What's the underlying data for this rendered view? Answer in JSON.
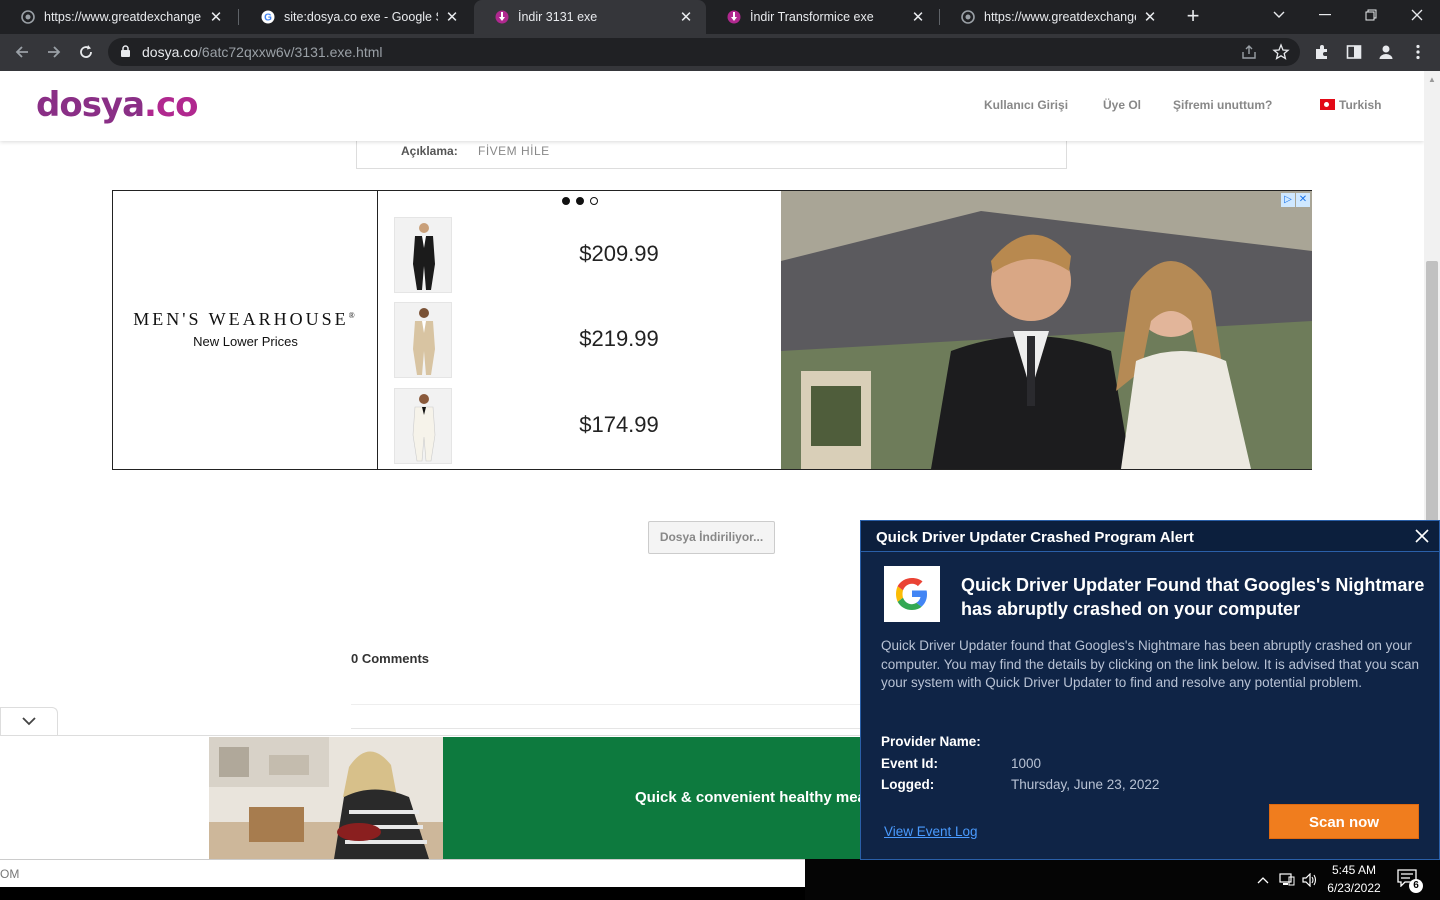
{
  "browser": {
    "tabs": [
      {
        "title": "https://www.greatdexchange.co",
        "icon": "globe-icon",
        "active": false
      },
      {
        "title": "site:dosya.co exe - Google Sear",
        "icon": "google-icon",
        "active": false
      },
      {
        "title": "İndir 3131 exe",
        "icon": "dosya-icon",
        "active": true
      },
      {
        "title": "İndir Transformice exe",
        "icon": "dosya-icon",
        "active": false
      },
      {
        "title": "https://www.greatdexchange.co",
        "icon": "globe-icon",
        "active": false
      }
    ],
    "url_host": "dosya.co",
    "url_path": "/6atc72qxxw6v/3131.exe.html"
  },
  "site": {
    "logo": "dosya",
    "logo_co": ".co",
    "nav": {
      "login": "Kullanıcı Girişi",
      "signup": "Üye Ol",
      "forgot": "Şifremi unuttum?",
      "language": "Turkish"
    },
    "description_label": "Açıklama:",
    "description_value": "FİVEM HİLE",
    "download_button": "Dosya İndiriliyor...",
    "comments": "0 Comments"
  },
  "ad": {
    "brand": "MEN'S WEARHOUSE",
    "brand_mark": "®",
    "tagline": "New Lower Prices",
    "prices": [
      "$209.99",
      "$219.99",
      "$174.99"
    ],
    "bottom_text": "Quick & convenient healthy mea"
  },
  "alert": {
    "window_title": "Quick Driver Updater Crashed Program Alert",
    "headline": "Quick Driver Updater Found that Googles's Nightmare has abruptly crashed on your computer",
    "body": "Quick Driver Updater found that Googles's Nightmare has been abruptly crashed on your computer. You may find the details by clicking on the link below. It is advised that you scan your system with Quick Driver Updater to find and resolve any potential problem.",
    "provider_label": "Provider Name:",
    "event_label": "Event Id:",
    "event_value": "1000",
    "logged_label": "Logged:",
    "logged_value": "Thursday, June 23, 2022",
    "link": "View Event Log",
    "button": "Scan now"
  },
  "shelf": {
    "text": "OM"
  },
  "taskbar": {
    "time": "5:45 AM",
    "date": "6/23/2022",
    "notifications": "6"
  }
}
